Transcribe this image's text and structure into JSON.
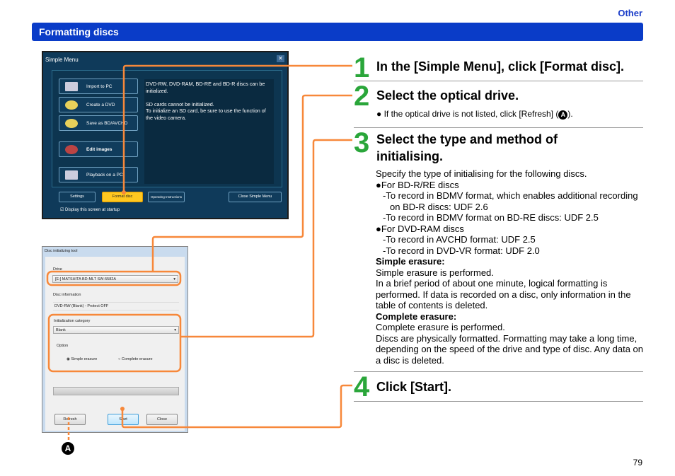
{
  "header": {
    "section": "Other",
    "title": "Formatting discs"
  },
  "simple_menu": {
    "title": "Simple Menu",
    "close": "✕",
    "buttons": [
      "Import to PC",
      "Create a DVD",
      "Save as BD/AVCHD",
      "Edit images",
      "Playback on a PC"
    ],
    "info": [
      "DVD-RW, DVD-RAM, BD-RE and BD-R discs can be initialized.",
      "SD cards cannot be initialized.",
      "To initialize an SD card, be sure to use the function of the video camera."
    ],
    "footer": {
      "settings": "Settings",
      "format": "Format disc",
      "instructions": "Operating Instructions",
      "close": "Close Simple Menu"
    },
    "startup_checkbox": "Display this screen at startup"
  },
  "disc_tool": {
    "title": "Disc initializing tool",
    "drive_label": "Drive",
    "drive_value": "[E:] MATSHITA BD-MLT SW-5582A",
    "info_label": "Disc information",
    "info_value": "DVD-RW (Blank) - Protect OFF",
    "category_label": "Initialization category",
    "category_value": "Blank",
    "option_label": "Option",
    "simple": "Simple erasure",
    "complete": "Complete erasure",
    "refresh": "Refresh",
    "start": "Start",
    "close": "Close"
  },
  "callout": "A",
  "steps": [
    {
      "num": "1",
      "heading": "In the [Simple Menu], click [Format disc]."
    },
    {
      "num": "2",
      "heading": "Select the optical drive.",
      "note": "● If the optical drive is not listed, click [Refresh] (",
      "note_end": ")."
    },
    {
      "num": "3",
      "heading": "Select the type and method of initialising.",
      "body": [
        {
          "t": "Specify the type of initialising for the following discs.",
          "c": ""
        },
        {
          "t": "●For BD-R/RE discs",
          "c": ""
        },
        {
          "t": "-To record in BDMV format, which enables additional recording",
          "c": "ind"
        },
        {
          "t": "on BD-R discs: UDF 2.6",
          "c": "ind2"
        },
        {
          "t": "-To record in BDMV format on BD-RE discs: UDF 2.5",
          "c": "ind"
        },
        {
          "t": "●For DVD-RAM discs",
          "c": ""
        },
        {
          "t": "-To record in AVCHD format:   UDF 2.5",
          "c": "ind"
        },
        {
          "t": "-To record in DVD-VR format: UDF 2.0",
          "c": "ind"
        },
        {
          "t": "Simple erasure:",
          "c": "b"
        },
        {
          "t": "Simple erasure is performed.",
          "c": ""
        },
        {
          "t": "In a brief period of about one minute, logical formatting is performed. If data is recorded on a disc, only information in the table of contents is deleted.",
          "c": ""
        },
        {
          "t": "Complete erasure:",
          "c": "b"
        },
        {
          "t": "Complete erasure is performed.",
          "c": ""
        },
        {
          "t": "Discs are physically formatted. Formatting may take a long time, depending on the speed of the drive and type of disc. Any data on a disc is deleted.",
          "c": ""
        }
      ]
    },
    {
      "num": "4",
      "heading": "Click [Start]."
    }
  ],
  "page_number": "79",
  "colors": {
    "accent": "#0a3cc8",
    "step_number": "#2aa63a",
    "connector": "#f7883a"
  }
}
